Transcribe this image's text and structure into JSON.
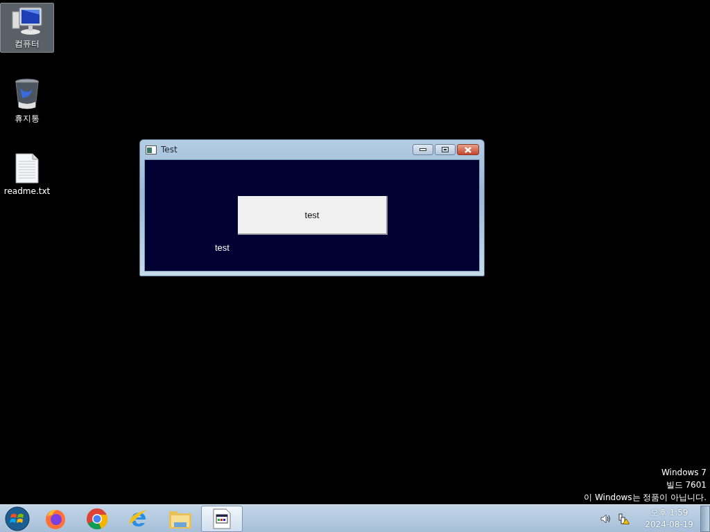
{
  "desktop_icons": [
    {
      "label": "컴퓨터",
      "kind": "computer",
      "selected": true
    },
    {
      "label": "휴지통",
      "kind": "recycle-bin",
      "selected": false
    },
    {
      "label": "readme.txt",
      "kind": "text-file",
      "selected": false
    }
  ],
  "window": {
    "title": "Test",
    "button": "test",
    "label": "test"
  },
  "activation_notice": [
    "Windows 7",
    "빌드 7601",
    "이 Windows는 정품이 아닙니다."
  ],
  "taskbar": {
    "apps": [
      {
        "kind": "firefox",
        "active": false
      },
      {
        "kind": "chrome",
        "active": false
      },
      {
        "kind": "browser-e",
        "active": false
      },
      {
        "kind": "folder",
        "active": false
      },
      {
        "kind": "app-window",
        "active": true
      }
    ],
    "clock": {
      "time": "오후 1:59",
      "date": "2024-08-19"
    }
  }
}
